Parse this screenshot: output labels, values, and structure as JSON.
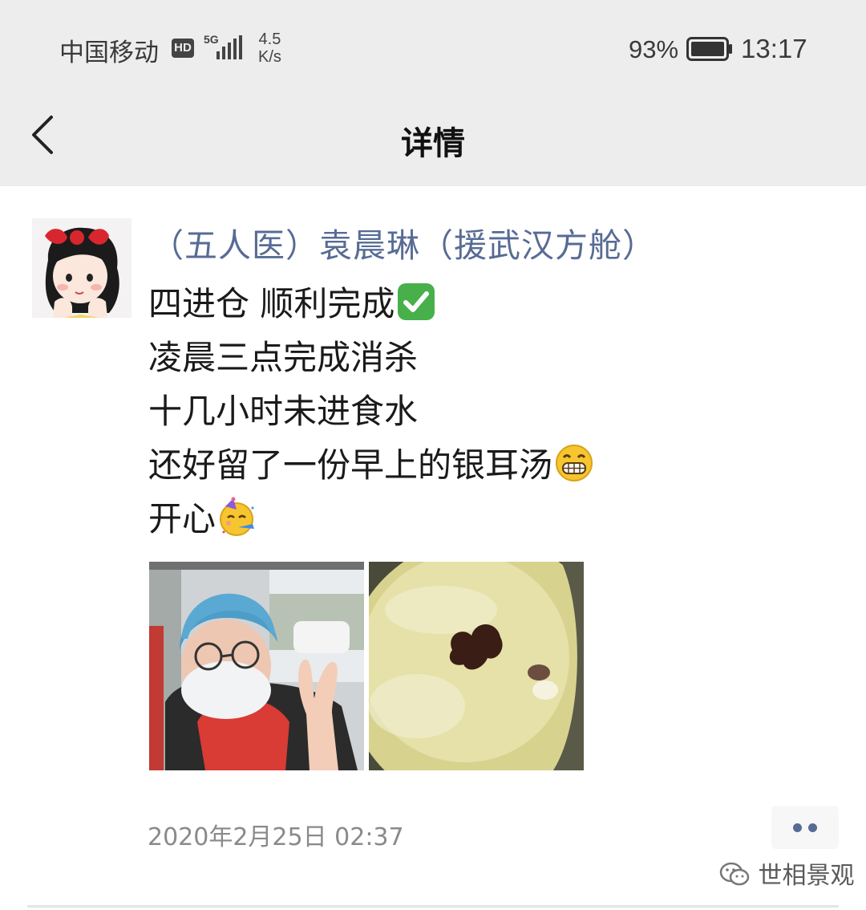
{
  "status_bar": {
    "carrier": "中国移动",
    "hd": "HD",
    "network": "5G",
    "speed_value": "4.5",
    "speed_unit": "K/s",
    "battery_percent": "93%",
    "time": "13:17"
  },
  "nav": {
    "title": "详情",
    "back_icon": "chevron-left-icon"
  },
  "post": {
    "author": "（五人医）袁晨琳（援武汉方舱）",
    "lines": [
      {
        "text": "四进仓 顺利完成",
        "emoji": "check-mark-button-emoji"
      },
      {
        "text": "凌晨三点完成消杀"
      },
      {
        "text": "十几小时未进食水"
      },
      {
        "text": "还好留了一份早上的银耳汤",
        "emoji": "grinning-face-emoji"
      },
      {
        "text": "开心",
        "emoji": "partying-face-emoji"
      }
    ],
    "photos": [
      "selfie-photo",
      "soup-photo"
    ],
    "timestamp": "2020年2月25日 02:37"
  },
  "watermark": {
    "icon": "wechat-channel-icon",
    "text": "世相景观"
  },
  "colors": {
    "bar_bg": "#ededed",
    "link": "#576b95",
    "meta": "#8a8a8a"
  }
}
